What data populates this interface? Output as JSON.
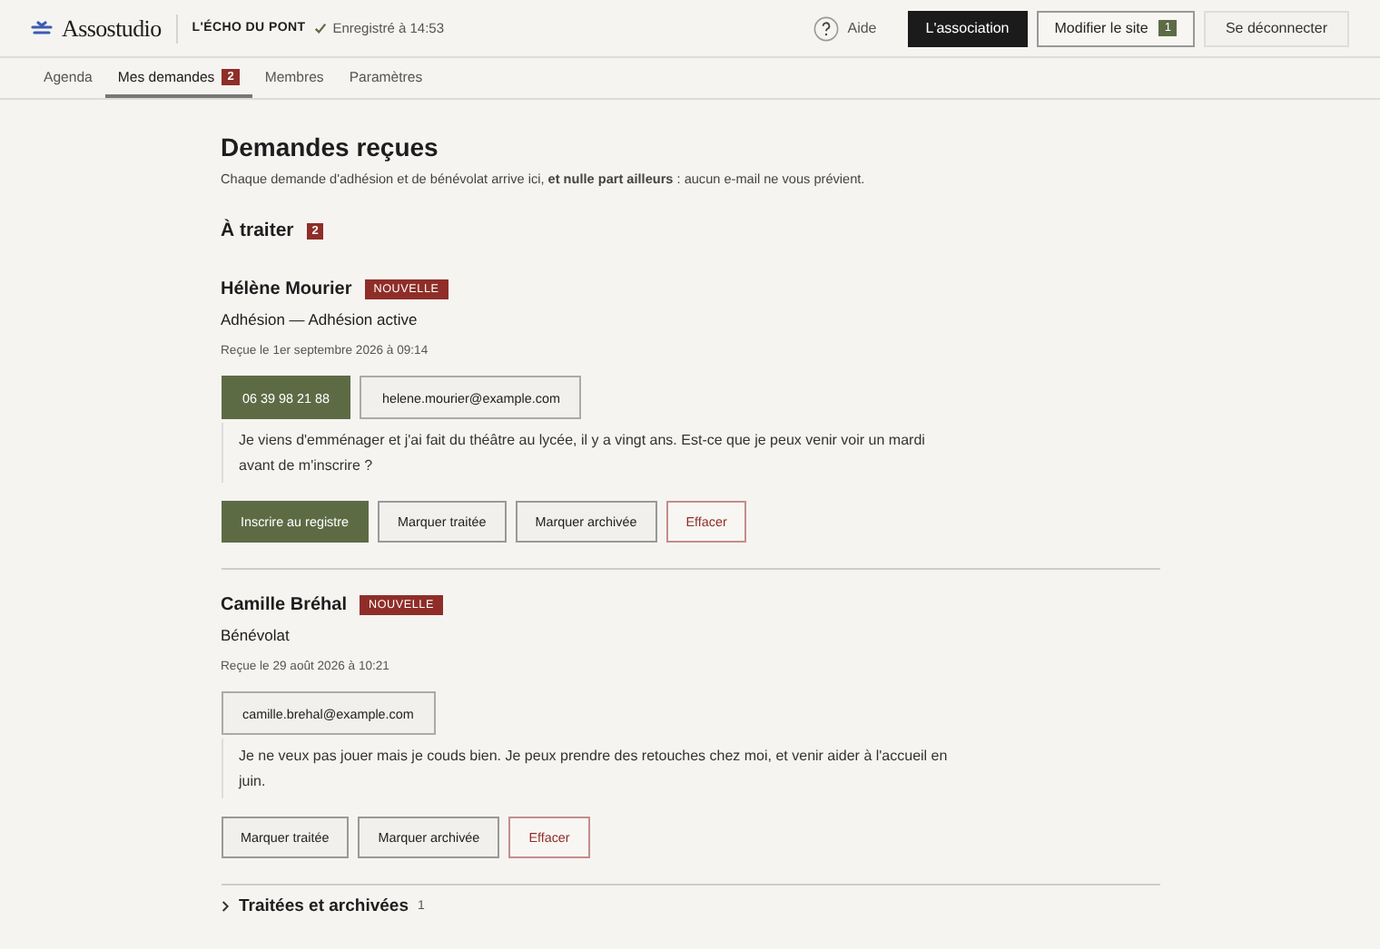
{
  "header": {
    "brand": "Assostudio",
    "site_name": "L'ÉCHO DU PONT",
    "save_status": "Enregistré à 14:53",
    "help": "Aide",
    "buttons": [
      {
        "label": "L'association",
        "kind": "dark"
      },
      {
        "label": "Modifier le site",
        "kind": "outline",
        "badge": "1"
      },
      {
        "label": "Se déconnecter",
        "kind": "plain"
      }
    ]
  },
  "tabs": [
    {
      "label": "Agenda",
      "selected": false
    },
    {
      "label": "Mes demandes",
      "selected": true,
      "badge": "2"
    },
    {
      "label": "Membres",
      "selected": false
    },
    {
      "label": "Paramètres",
      "selected": false
    }
  ],
  "page": {
    "title": "Demandes reçues",
    "intro": "Chaque demande d'adhésion et de bénévolat arrive ici, **et nulle part ailleurs** : aucun e-mail ne vous prévient.",
    "section_title": "À traiter",
    "section_count": "2"
  },
  "requests": [
    {
      "name": "Hélène Mourier",
      "tag": "NOUVELLE",
      "type": "Adhésion — Adhésion active",
      "received": "Reçue le 1er septembre 2026 à 09:14",
      "contacts": [
        {
          "label": "06 39 98 21 88",
          "kind": "phone"
        },
        {
          "label": "helene.mourier@example.com",
          "kind": "email"
        }
      ],
      "message": "Je viens d'emménager et j'ai fait du théâtre au lycée, il y a vingt ans. Est-ce que je peux venir voir un mardi avant de m'inscrire ?",
      "actions": [
        {
          "label": "Inscrire au registre",
          "kind": "primary"
        },
        {
          "label": "Marquer traitée",
          "kind": "secondary"
        },
        {
          "label": "Marquer archivée",
          "kind": "secondary"
        },
        {
          "label": "Effacer",
          "kind": "danger"
        }
      ]
    },
    {
      "name": "Camille Bréhal",
      "tag": "NOUVELLE",
      "type": "Bénévolat",
      "received": "Reçue le 29 août 2026 à 10:21",
      "contacts": [
        {
          "label": "camille.brehal@example.com",
          "kind": "email"
        }
      ],
      "message": "Je ne veux pas jouer mais je couds bien. Je peux prendre des retouches chez moi, et venir aider à l'accueil en juin.",
      "actions": [
        {
          "label": "Marquer traitée",
          "kind": "secondary"
        },
        {
          "label": "Marquer archivée",
          "kind": "secondary"
        },
        {
          "label": "Effacer",
          "kind": "danger"
        }
      ]
    }
  ],
  "archived": {
    "label": "Traitées et archivées",
    "count": "1",
    "expanded": false
  }
}
